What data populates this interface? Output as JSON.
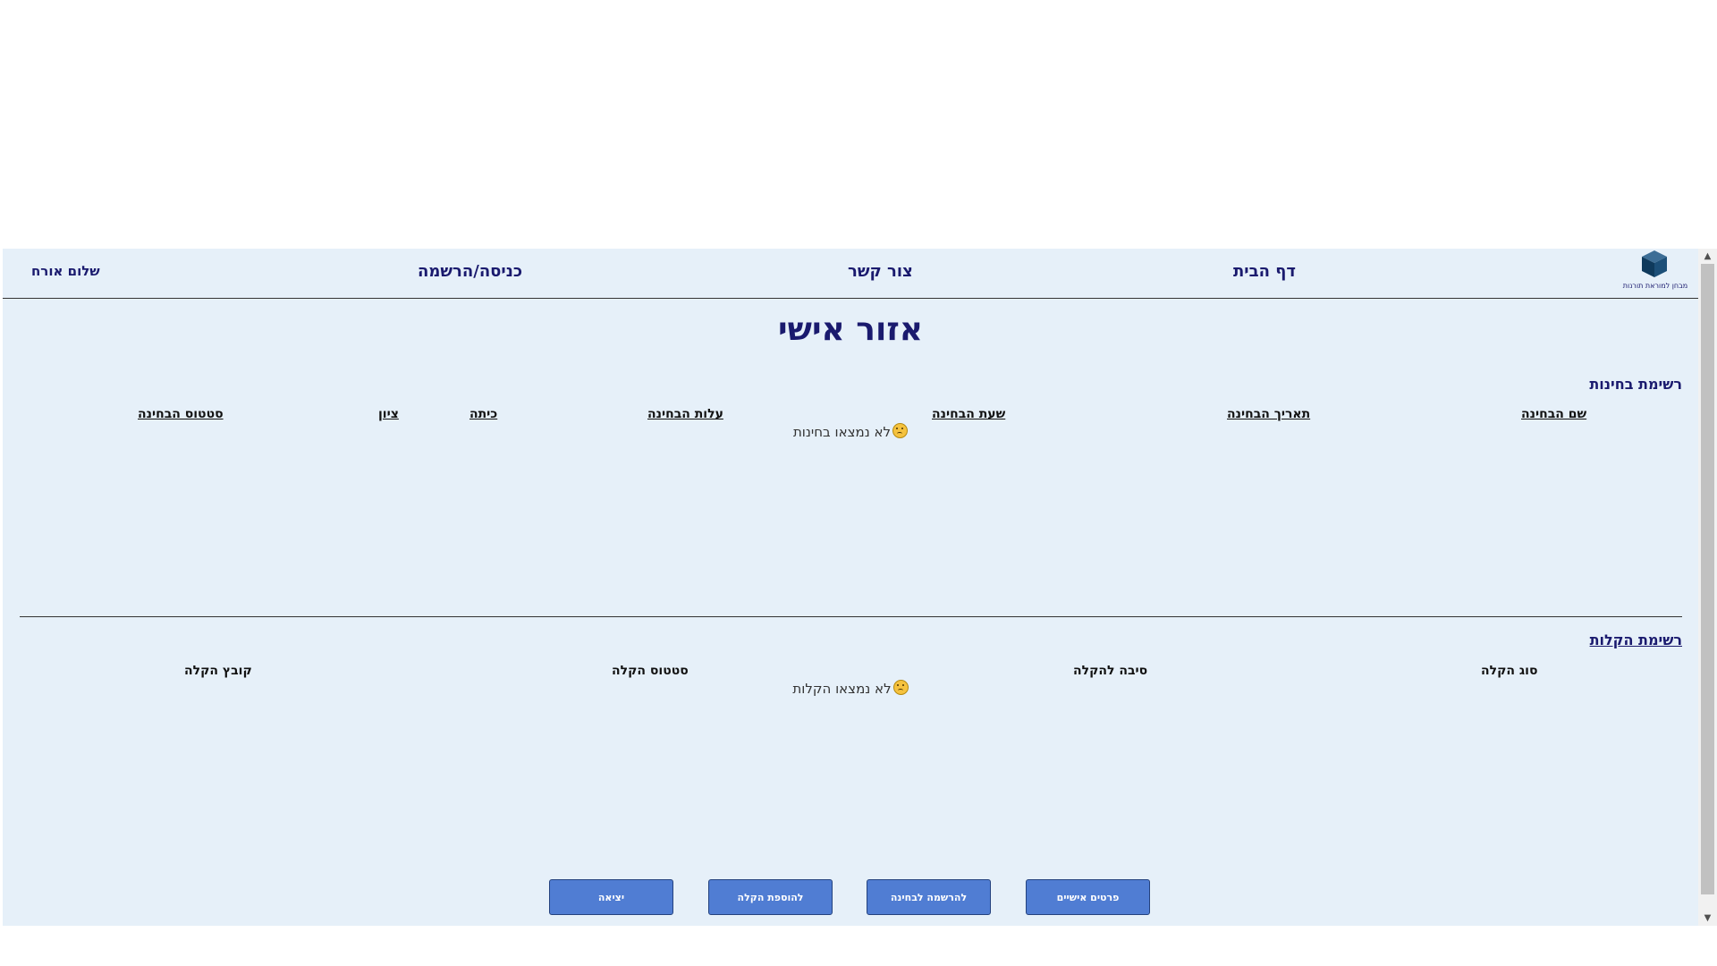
{
  "header": {
    "logo_text": "מבחן למוראת תורנות",
    "nav": {
      "home": "דף הבית",
      "contact": "צור קשר",
      "login": "כניסה/הרשמה"
    },
    "greeting": "שלום אורח"
  },
  "page_title": "אזור אישי",
  "exams": {
    "title": "רשימת בחינות",
    "columns": [
      "שם הבחינה",
      "תאריך הבחינה",
      "שעת הבחינה",
      "עלות הבחינה",
      "כיתה",
      "ציון",
      "סטטוס הבחינה"
    ],
    "empty_message": "לא נמצאו בחינות"
  },
  "accommodations": {
    "title": "רשימת הקלות",
    "columns": [
      "סוג הקלה",
      "סיבה להקלה",
      "סטטוס הקלה",
      "קובץ הקלה"
    ],
    "empty_message": "לא נמצאו הקלות"
  },
  "buttons": {
    "personal_details": "פרטים אישיים",
    "register_exam": "להרשמה לבחינה",
    "add_accommodation": "להוספת הקלה",
    "exit": "יציאה"
  },
  "colors": {
    "background": "#e6f0f9",
    "primary_text": "#1a1a6e",
    "button": "#507dd3"
  }
}
